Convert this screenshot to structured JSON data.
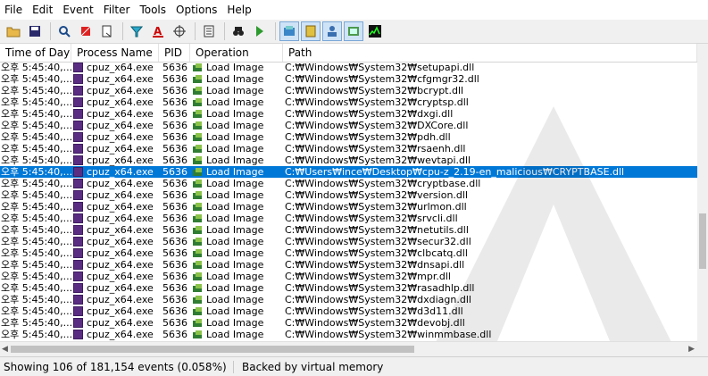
{
  "menu": [
    "File",
    "Edit",
    "Event",
    "Filter",
    "Tools",
    "Options",
    "Help"
  ],
  "toolbar": [
    {
      "icon": "open-folder-icon",
      "pressed": false
    },
    {
      "icon": "save-disk-icon",
      "pressed": false
    },
    {
      "sep": true
    },
    {
      "icon": "magnifier-icon",
      "pressed": false
    },
    {
      "icon": "capture-icon",
      "pressed": false
    },
    {
      "icon": "autoscroll-icon",
      "pressed": false
    },
    {
      "sep": true
    },
    {
      "icon": "filter-funnel-icon",
      "pressed": false
    },
    {
      "icon": "highlight-icon",
      "pressed": false
    },
    {
      "icon": "crosshair-icon",
      "pressed": false
    },
    {
      "sep": true
    },
    {
      "icon": "process-tree-icon",
      "pressed": false
    },
    {
      "sep": true
    },
    {
      "icon": "binoculars-find-icon",
      "pressed": false
    },
    {
      "icon": "jump-to-icon",
      "pressed": false
    },
    {
      "sep": true
    },
    {
      "icon": "registry-activity-icon",
      "pressed": true
    },
    {
      "icon": "filesystem-activity-icon",
      "pressed": true
    },
    {
      "icon": "network-activity-icon",
      "pressed": true
    },
    {
      "icon": "process-thread-activity-icon",
      "pressed": true
    },
    {
      "icon": "profiling-events-icon",
      "pressed": false
    }
  ],
  "columns": [
    "Time of Day",
    "Process Name",
    "PID",
    "Operation",
    "Path"
  ],
  "rows": [
    {
      "time": "오후 5:45:40,...",
      "process": "cpuz_x64.exe",
      "pid": "5636",
      "operation": "Load Image",
      "path": "C:₩Windows₩System32₩setupapi.dll"
    },
    {
      "time": "오후 5:45:40,...",
      "process": "cpuz_x64.exe",
      "pid": "5636",
      "operation": "Load Image",
      "path": "C:₩Windows₩System32₩cfgmgr32.dll"
    },
    {
      "time": "오후 5:45:40,...",
      "process": "cpuz_x64.exe",
      "pid": "5636",
      "operation": "Load Image",
      "path": "C:₩Windows₩System32₩bcrypt.dll"
    },
    {
      "time": "오후 5:45:40,...",
      "process": "cpuz_x64.exe",
      "pid": "5636",
      "operation": "Load Image",
      "path": "C:₩Windows₩System32₩cryptsp.dll"
    },
    {
      "time": "오후 5:45:40,...",
      "process": "cpuz_x64.exe",
      "pid": "5636",
      "operation": "Load Image",
      "path": "C:₩Windows₩System32₩dxgi.dll"
    },
    {
      "time": "오후 5:45:40,...",
      "process": "cpuz_x64.exe",
      "pid": "5636",
      "operation": "Load Image",
      "path": "C:₩Windows₩System32₩DXCore.dll"
    },
    {
      "time": "오후 5:45:40,...",
      "process": "cpuz_x64.exe",
      "pid": "5636",
      "operation": "Load Image",
      "path": "C:₩Windows₩System32₩pdh.dll"
    },
    {
      "time": "오후 5:45:40,...",
      "process": "cpuz_x64.exe",
      "pid": "5636",
      "operation": "Load Image",
      "path": "C:₩Windows₩System32₩rsaenh.dll"
    },
    {
      "time": "오후 5:45:40,...",
      "process": "cpuz_x64.exe",
      "pid": "5636",
      "operation": "Load Image",
      "path": "C:₩Windows₩System32₩wevtapi.dll"
    },
    {
      "time": "오후 5:45:40,...",
      "process": "cpuz_x64.exe",
      "pid": "5636",
      "operation": "Load Image",
      "path": "C:₩Users₩ince₩Desktop₩cpu-z_2.19-en_malicious₩CRYPTBASE.dll",
      "selected": true
    },
    {
      "time": "오후 5:45:40,...",
      "process": "cpuz_x64.exe",
      "pid": "5636",
      "operation": "Load Image",
      "path": "C:₩Windows₩System32₩cryptbase.dll"
    },
    {
      "time": "오후 5:45:40,...",
      "process": "cpuz_x64.exe",
      "pid": "5636",
      "operation": "Load Image",
      "path": "C:₩Windows₩System32₩version.dll"
    },
    {
      "time": "오후 5:45:40,...",
      "process": "cpuz_x64.exe",
      "pid": "5636",
      "operation": "Load Image",
      "path": "C:₩Windows₩System32₩urlmon.dll"
    },
    {
      "time": "오후 5:45:40,...",
      "process": "cpuz_x64.exe",
      "pid": "5636",
      "operation": "Load Image",
      "path": "C:₩Windows₩System32₩srvcli.dll"
    },
    {
      "time": "오후 5:45:40,...",
      "process": "cpuz_x64.exe",
      "pid": "5636",
      "operation": "Load Image",
      "path": "C:₩Windows₩System32₩netutils.dll"
    },
    {
      "time": "오후 5:45:40,...",
      "process": "cpuz_x64.exe",
      "pid": "5636",
      "operation": "Load Image",
      "path": "C:₩Windows₩System32₩secur32.dll"
    },
    {
      "time": "오후 5:45:40,...",
      "process": "cpuz_x64.exe",
      "pid": "5636",
      "operation": "Load Image",
      "path": "C:₩Windows₩System32₩clbcatq.dll"
    },
    {
      "time": "오후 5:45:40,...",
      "process": "cpuz_x64.exe",
      "pid": "5636",
      "operation": "Load Image",
      "path": "C:₩Windows₩System32₩dnsapi.dll"
    },
    {
      "time": "오후 5:45:40,...",
      "process": "cpuz_x64.exe",
      "pid": "5636",
      "operation": "Load Image",
      "path": "C:₩Windows₩System32₩mpr.dll"
    },
    {
      "time": "오후 5:45:40,...",
      "process": "cpuz_x64.exe",
      "pid": "5636",
      "operation": "Load Image",
      "path": "C:₩Windows₩System32₩rasadhlp.dll"
    },
    {
      "time": "오후 5:45:40,...",
      "process": "cpuz_x64.exe",
      "pid": "5636",
      "operation": "Load Image",
      "path": "C:₩Windows₩System32₩dxdiagn.dll"
    },
    {
      "time": "오후 5:45:40,...",
      "process": "cpuz_x64.exe",
      "pid": "5636",
      "operation": "Load Image",
      "path": "C:₩Windows₩System32₩d3d11.dll"
    },
    {
      "time": "오후 5:45:40,...",
      "process": "cpuz_x64.exe",
      "pid": "5636",
      "operation": "Load Image",
      "path": "C:₩Windows₩System32₩devobj.dll"
    },
    {
      "time": "오후 5:45:40,...",
      "process": "cpuz_x64.exe",
      "pid": "5636",
      "operation": "Load Image",
      "path": "C:₩Windows₩System32₩winmmbase.dll"
    }
  ],
  "status": {
    "events": "Showing 106 of 181,154 events (0.058%)",
    "memory": "Backed by virtual memory"
  },
  "colors": {
    "selection": "#0078d7",
    "process_icon": "#5a2d82",
    "load_image_icon": "#2f7d32"
  }
}
